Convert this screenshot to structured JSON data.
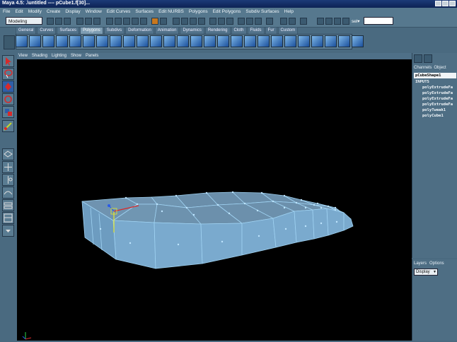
{
  "window": {
    "title": "Maya 4.5: .\\untitled  ----  pCube1.f[30]..."
  },
  "menubar": {
    "items": [
      "File",
      "Edit",
      "Modify",
      "Create",
      "Display",
      "Window",
      "Edit Curves",
      "Surfaces",
      "Edit NURBS",
      "Polygons",
      "Edit Polygons",
      "Subdiv Surfaces",
      "Help"
    ]
  },
  "statusline": {
    "mode": "Modeling",
    "select_label": "sel▾"
  },
  "shelf": {
    "tabs": [
      "General",
      "Curves",
      "Surfaces",
      "Polygons",
      "Subdivs",
      "Deformation",
      "Animation",
      "Dynamics",
      "Rendering",
      "Cloth",
      "Fluids",
      "Fur",
      "Custom"
    ],
    "active_tab": "Polygons"
  },
  "viewport": {
    "menu": [
      "View",
      "Shading",
      "Lighting",
      "Show",
      "Panels"
    ]
  },
  "channel_box": {
    "tabs": [
      "Channels",
      "Object"
    ],
    "shape_name": "pCubeShape1",
    "inputs_label": "INPUTS",
    "inputs": [
      "polyExtrudeFa",
      "polyExtrudeFa",
      "polyExtrudeFa",
      "polyExtrudeFa",
      "polyTweak1",
      "polyCube1"
    ]
  },
  "layers": {
    "tabs": [
      "Layers",
      "Options"
    ],
    "display_value": "Display"
  },
  "colors": {
    "mesh_face": "#7aaace",
    "mesh_edge": "#9fd2f2",
    "viewport_bg": "#000000",
    "ui_panel": "#56788e"
  }
}
